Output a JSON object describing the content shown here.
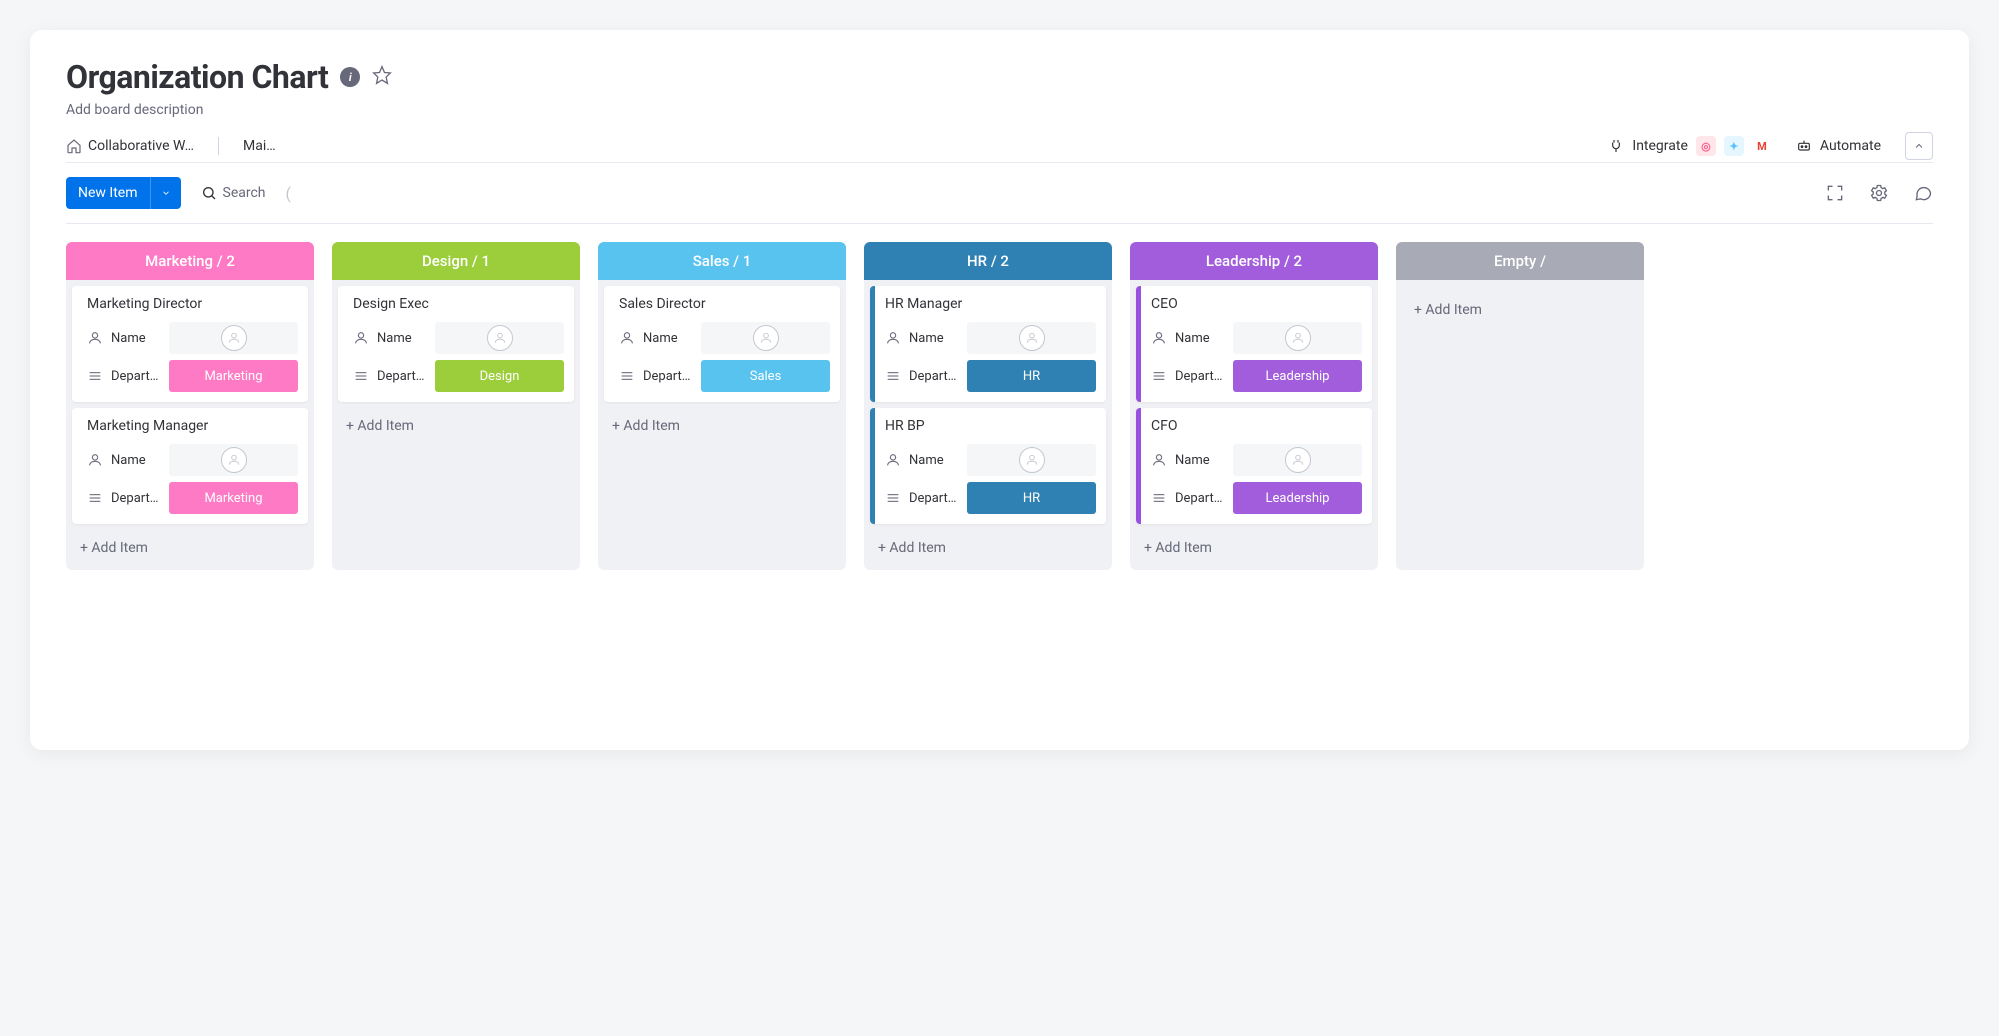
{
  "header": {
    "title": "Organization Chart",
    "description": "Add board description"
  },
  "tabs": {
    "workspace": "Collaborative W…",
    "view": "Mai…"
  },
  "actions": {
    "integrate": "Integrate",
    "automate": "Automate"
  },
  "toolbar": {
    "new_item": "New Item",
    "search": "Search"
  },
  "fields": {
    "name_label": "Name",
    "dept_label": "Depart…"
  },
  "common": {
    "add_item": "+ Add Item"
  },
  "columns": [
    {
      "id": "marketing",
      "title": "Marketing / 2",
      "dept_value": "Marketing",
      "cards": [
        {
          "title": "Marketing Director"
        },
        {
          "title": "Marketing Manager"
        }
      ]
    },
    {
      "id": "design",
      "title": "Design / 1",
      "dept_value": "Design",
      "cards": [
        {
          "title": "Design Exec"
        }
      ]
    },
    {
      "id": "sales",
      "title": "Sales / 1",
      "dept_value": "Sales",
      "cards": [
        {
          "title": "Sales Director"
        }
      ]
    },
    {
      "id": "hr",
      "title": "HR / 2",
      "dept_value": "HR",
      "cards": [
        {
          "title": "HR Manager"
        },
        {
          "title": "HR BP"
        }
      ]
    },
    {
      "id": "leadership",
      "title": "Leadership / 2",
      "dept_value": "Leadership",
      "cards": [
        {
          "title": "CEO"
        },
        {
          "title": "CFO"
        }
      ]
    },
    {
      "id": "empty",
      "title": "Empty /",
      "dept_value": "",
      "cards": []
    }
  ]
}
